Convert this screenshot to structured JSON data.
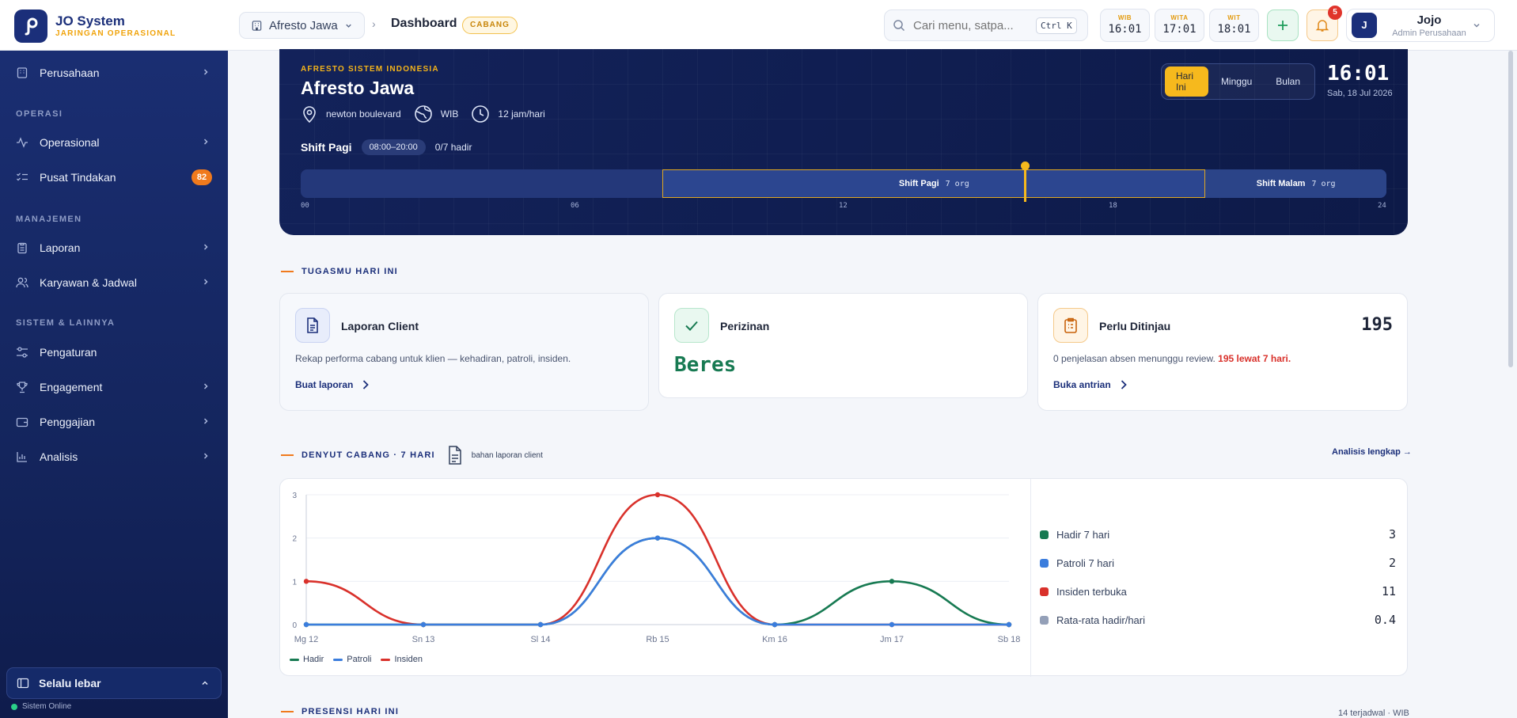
{
  "brand": {
    "name": "JO System",
    "subtitle": "JARINGAN OPERASIONAL",
    "color": "#1b2f7a"
  },
  "header": {
    "branch": "Afresto Jawa",
    "breadcrumb_title": "Dashboard",
    "breadcrumb_badge": "CABANG",
    "search_placeholder": "Cari menu, satpa...",
    "search_shortcut": "Ctrl K",
    "clocks": [
      {
        "zone": "WIB",
        "time": "16:01"
      },
      {
        "zone": "WITA",
        "time": "17:01"
      },
      {
        "zone": "WIT",
        "time": "18:01"
      }
    ],
    "notification_count": "5",
    "user": {
      "initial": "J",
      "name": "Jojo",
      "role": "Admin Perusahaan"
    }
  },
  "sidebar": {
    "items_top": [
      {
        "label": "Perusahaan",
        "icon": "building-icon"
      }
    ],
    "sections": [
      {
        "title": "OPERASI",
        "items": [
          {
            "label": "Operasional",
            "icon": "activity-icon"
          },
          {
            "label": "Pusat Tindakan",
            "icon": "checklist-icon",
            "badge": "82"
          }
        ]
      },
      {
        "title": "MANAJEMEN",
        "items": [
          {
            "label": "Laporan",
            "icon": "clipboard-icon"
          },
          {
            "label": "Karyawan & Jadwal",
            "icon": "users-icon"
          }
        ]
      },
      {
        "title": "SISTEM & LAINNYA",
        "items": [
          {
            "label": "Pengaturan",
            "icon": "sliders-icon"
          },
          {
            "label": "Engagement",
            "icon": "trophy-icon"
          },
          {
            "label": "Penggajian",
            "icon": "wallet-icon"
          },
          {
            "label": "Analisis",
            "icon": "bar-chart-icon"
          }
        ]
      }
    ],
    "wide_toggle": "Selalu lebar",
    "status": "Sistem Online"
  },
  "hero": {
    "kicker": "AFRESTO SISTEM INDONESIA",
    "title": "Afresto Jawa",
    "location": "newton boulevard",
    "timezone": "WIB",
    "hours": "12 jam/hari",
    "shift_name": "Shift Pagi",
    "shift_hours": "08:00–20:00",
    "shift_count": "0/7 hadir",
    "ranges": [
      "Hari Ini",
      "Minggu",
      "Bulan"
    ],
    "active_range": "Hari Ini",
    "clock": "16:01",
    "date": "Sab, 18 Jul 2026",
    "timeline": {
      "segments": [
        {
          "label": "Shift Pagi",
          "count": "7 org",
          "start_hour": 8,
          "end_hour": 20
        },
        {
          "label": "Shift Malam",
          "count": "7 org",
          "start_hour": 20,
          "end_hour": 24
        }
      ],
      "now_hour": 16.02,
      "ticks": [
        "00",
        "06",
        "12",
        "18",
        "24"
      ]
    }
  },
  "tasks": {
    "heading": "TUGASMU HARI INI",
    "cards": [
      {
        "title": "Laporan Client",
        "desc": "Rekap performa cabang untuk klien — kehadiran, patroli, insiden.",
        "link": "Buat laporan"
      },
      {
        "title": "Perizinan",
        "big": "Beres"
      },
      {
        "title": "Perlu Ditinjau",
        "number": "195",
        "desc": "0 penjelasan absen menunggu review.",
        "desc_alert": "195 lewat 7 hari.",
        "link": "Buka antrian"
      }
    ]
  },
  "pulse": {
    "heading": "DENYUT CABANG · 7 HARI",
    "note": "bahan laporan client",
    "link": "Analisis lengkap →",
    "stats": [
      {
        "label": "Hadir 7 hari",
        "value": "3",
        "color": "#177a52"
      },
      {
        "label": "Patroli 7 hari",
        "value": "2",
        "color": "#3b7ddd"
      },
      {
        "label": "Insiden terbuka",
        "value": "11",
        "color": "#d9312b"
      },
      {
        "label": "Rata-rata hadir/hari",
        "value": "0.4",
        "color": "#94a0b8"
      }
    ]
  },
  "chart_data": {
    "type": "line",
    "categories": [
      "Mg 12",
      "Sn 13",
      "Sl 14",
      "Rb 15",
      "Km 16",
      "Jm 17",
      "Sb 18"
    ],
    "series": [
      {
        "name": "Hadir",
        "color": "#177a52",
        "values": [
          0,
          0,
          0,
          2,
          0,
          1,
          0
        ]
      },
      {
        "name": "Patroli",
        "color": "#3b7ddd",
        "values": [
          0,
          0,
          0,
          2,
          0,
          0,
          0
        ]
      },
      {
        "name": "Insiden",
        "color": "#d9312b",
        "values": [
          1,
          0,
          0,
          3,
          0,
          0,
          0
        ]
      }
    ],
    "ylim": [
      0,
      3
    ],
    "yticks": [
      "0",
      "1",
      "2",
      "3"
    ],
    "grid": true,
    "legend": "bottom-left"
  },
  "presence": {
    "heading": "PRESENSI HARI INI",
    "meta": "14 terjadwal · WIB"
  }
}
